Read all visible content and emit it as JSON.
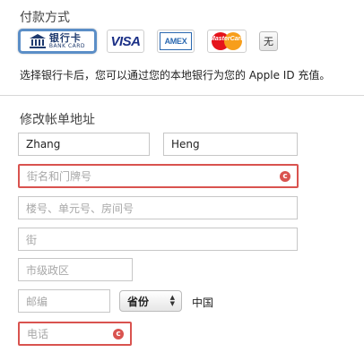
{
  "payment": {
    "heading": "付款方式",
    "options": {
      "bank_label_cn": "银行卡",
      "bank_label_en": "BANK CARD",
      "visa": "VISA",
      "amex": "AMEX",
      "mastercard": "MasterCard",
      "none": "无"
    },
    "selected": "bank-card",
    "description": "选择银行卡后，您可以通过您的本地银行为您的 Apple ID 充值。"
  },
  "address": {
    "heading": "修改帐单地址",
    "first_name": "Zhang",
    "last_name": "Heng",
    "street_placeholder": "街名和门牌号",
    "unit_placeholder": "楼号、单元号、房间号",
    "street2_placeholder": "街",
    "city_placeholder": "市级政区",
    "postal_placeholder": "邮编",
    "province_select": "省份",
    "country": "中国",
    "phone_placeholder": "电话"
  },
  "colors": {
    "error_border": "#d9534f",
    "selected_border": "#5b8ec7"
  }
}
